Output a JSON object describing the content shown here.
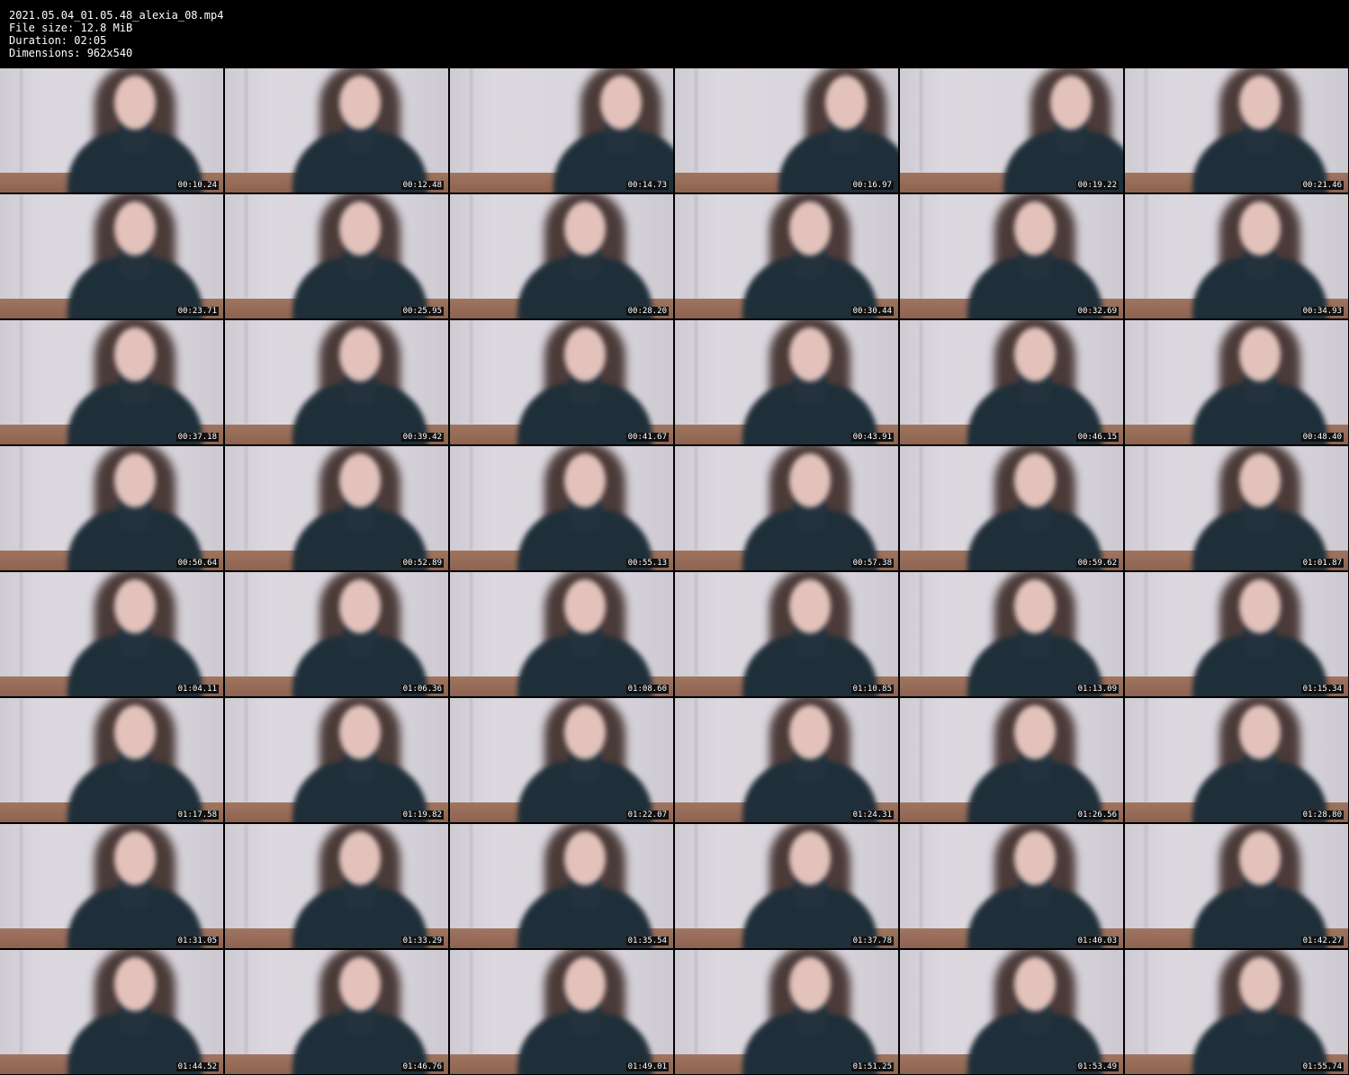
{
  "header": {
    "filename": "2021.05.04_01.05.48_alexia_08.mp4",
    "file_size": "File size: 12.8 MiB",
    "duration": "Duration: 02:05",
    "dimensions": "Dimensions: 962x540"
  },
  "thumbnails": [
    "00:10.24",
    "00:12.48",
    "00:14.73",
    "00:16.97",
    "00:19.22",
    "00:21.46",
    "00:23.71",
    "00:25.95",
    "00:28.20",
    "00:30.44",
    "00:32.69",
    "00:34.93",
    "00:37.18",
    "00:39.42",
    "00:41.67",
    "00:43.91",
    "00:46.15",
    "00:48.40",
    "00:50.64",
    "00:52.89",
    "00:55.13",
    "00:57.38",
    "00:59.62",
    "01:01.87",
    "01:04.11",
    "01:06.36",
    "01:08.60",
    "01:10.85",
    "01:13.09",
    "01:15.34",
    "01:17.58",
    "01:19.82",
    "01:22.07",
    "01:24.31",
    "01:26.56",
    "01:28.80",
    "01:31.05",
    "01:33.29",
    "01:35.54",
    "01:37.78",
    "01:40.03",
    "01:42.27",
    "01:44.52",
    "01:46.76",
    "01:49.01",
    "01:51.25",
    "01:53.49",
    "01:55.74"
  ],
  "colors": {
    "background": "#000000",
    "header_text": "#ffffff"
  }
}
